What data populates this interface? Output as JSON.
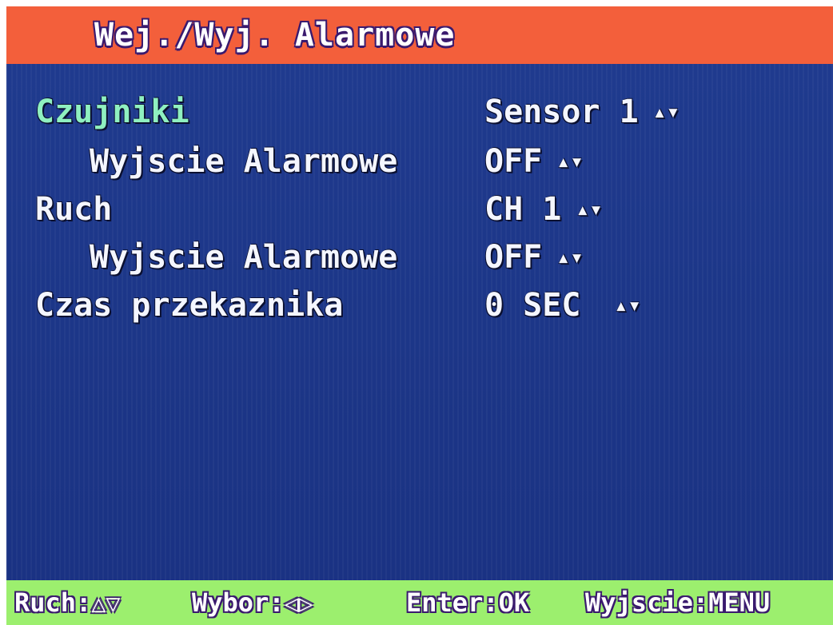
{
  "title": "Wej./Wyj. Alarmowe",
  "menu": {
    "rows": [
      {
        "label": "Czujniki",
        "value": "Sensor 1",
        "arrow": "▴▾"
      },
      {
        "label": "Wyjscie Alarmowe",
        "value": "OFF",
        "arrow": "▴▾"
      },
      {
        "label": "Ruch",
        "value": "CH 1",
        "arrow": "▴▾"
      },
      {
        "label": "Wyjscie Alarmowe",
        "value": "OFF",
        "arrow": "▴▾"
      },
      {
        "label": "Czas przekaznika",
        "value": "0 SEC",
        "arrow": "▴▾"
      }
    ]
  },
  "help": {
    "move_label": "Ruch:",
    "move_glyphs": "△▽",
    "select_label": "Wybor:",
    "select_glyphs": "◁▷",
    "enter_label": "Enter:OK",
    "exit_label": "Wyjscie:MENU"
  },
  "colors": {
    "title_bar": "#f35f3b",
    "panel": "#1f3a8e",
    "help_bar": "#9cef6e",
    "selected_text": "#8ff0c0",
    "text": "#f4f6ff"
  },
  "icons": {
    "value_arrow": "up-down-arrow-icon",
    "move": "up-down-triangle-icon",
    "select": "left-right-triangle-icon"
  }
}
